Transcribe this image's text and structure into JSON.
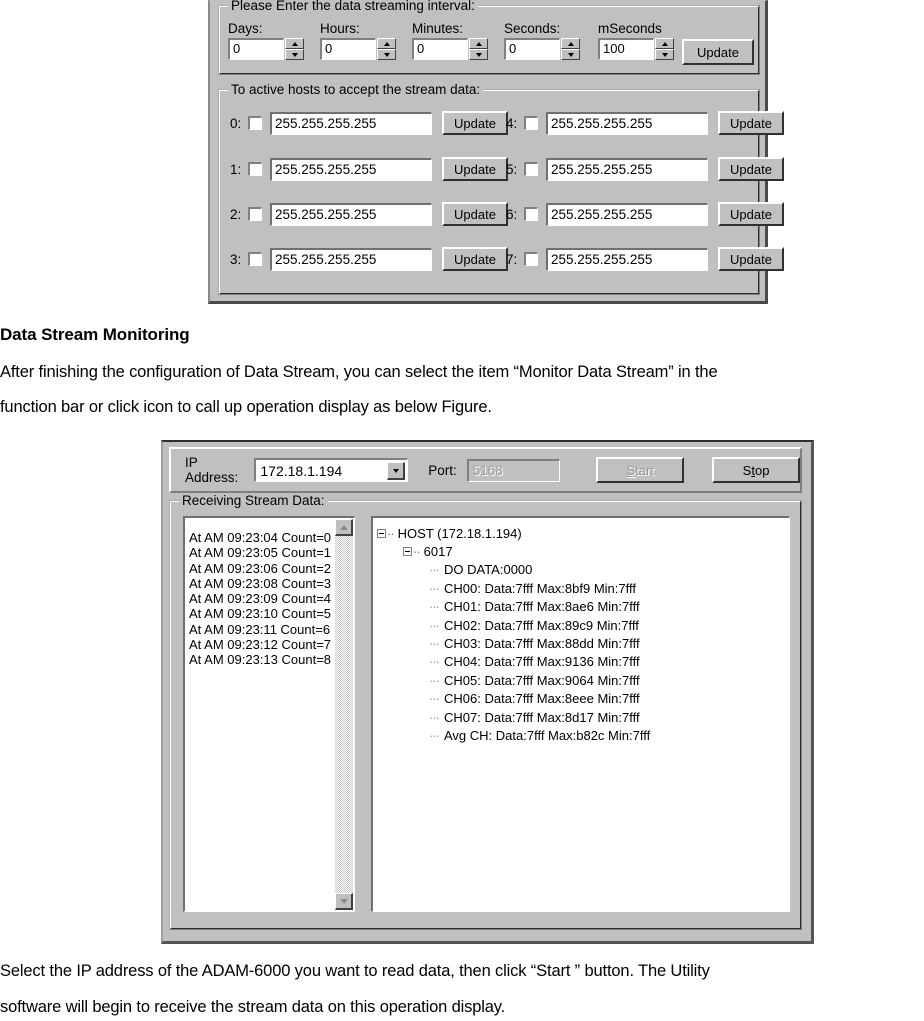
{
  "top_dialog": {
    "interval_group": {
      "legend": "Please Enter the data streaming interval:",
      "fields": [
        {
          "label": "Days:",
          "value": "0"
        },
        {
          "label": "Hours:",
          "value": "0"
        },
        {
          "label": "Minutes:",
          "value": "0"
        },
        {
          "label": "Seconds:",
          "value": "0"
        },
        {
          "label": "mSeconds",
          "value": "100"
        }
      ],
      "update_label": "Update"
    },
    "hosts_group": {
      "legend": "To active hosts to accept  the stream data:",
      "update_label": "Update",
      "rows": [
        {
          "index": "0:",
          "ip": "255.255.255.255",
          "checked": false
        },
        {
          "index": "1:",
          "ip": "255.255.255.255",
          "checked": false
        },
        {
          "index": "2:",
          "ip": "255.255.255.255",
          "checked": false
        },
        {
          "index": "3:",
          "ip": "255.255.255.255",
          "checked": false
        },
        {
          "index": "4:",
          "ip": "255.255.255.255",
          "checked": false
        },
        {
          "index": "5:",
          "ip": "255.255.255.255",
          "checked": false
        },
        {
          "index": "6:",
          "ip": "255.255.255.255",
          "checked": false
        },
        {
          "index": "7:",
          "ip": "255.255.255.255",
          "checked": false
        }
      ]
    }
  },
  "document": {
    "heading": "Data Stream Monitoring",
    "paragraph_line1": "After finishing the configuration of Data Stream, you can select the item “Monitor Data Stream” in the",
    "paragraph_line2": "function bar or click icon to call up operation display as below Figure.",
    "caption_line1": "Select the IP address of the ADAM-6000 you want to read data, then click “Start ” button. The Utility",
    "caption_line2": "software will begin to receive the stream data on this operation display."
  },
  "monitor_window": {
    "toolbar": {
      "ip_label": "IP Address:",
      "ip_value": "172.18.1.194",
      "port_label": "Port:",
      "port_value": "5168",
      "start_label": "Start",
      "start_accel": "S",
      "stop_label": "Stop",
      "stop_accel": "t"
    },
    "receiving_group_legend": "Receiving Stream Data:",
    "log_items": [
      "At AM 09:23:04 Count=0",
      "At AM 09:23:05 Count=1",
      "At AM 09:23:06 Count=2",
      "At AM 09:23:08 Count=3",
      "At AM 09:23:09 Count=4",
      "At AM 09:23:10 Count=5",
      "At AM 09:23:11 Count=6",
      "At AM 09:23:12 Count=7",
      "At AM 09:23:13 Count=8"
    ],
    "tree": {
      "root": "HOST (172.18.1.194)",
      "module": "6017",
      "leaves": [
        "DO DATA:0000",
        "CH00:  Data:7fff    Max:8bf9   Min:7fff",
        "CH01:  Data:7fff    Max:8ae6   Min:7fff",
        "CH02:  Data:7fff    Max:89c9   Min:7fff",
        "CH03:  Data:7fff    Max:88dd   Min:7fff",
        "CH04:  Data:7fff    Max:9136   Min:7fff",
        "CH05:  Data:7fff    Max:9064   Min:7fff",
        "CH06:  Data:7fff    Max:8eee   Min:7fff",
        "CH07:  Data:7fff    Max:8d17   Min:7fff",
        "Avg CH:  Data:7fff   Max:b82c   Min:7fff"
      ]
    }
  },
  "colors": {
    "window_face": "#c0c0c0",
    "field_bg": "#ffffff",
    "shadow": "#808080",
    "highlight": "#ffffff",
    "disabled_text": "#9a9a9a"
  }
}
